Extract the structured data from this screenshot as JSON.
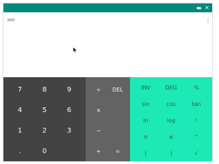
{
  "window": {
    "controls": [
      {
        "name": "minimize-icon",
        "glyph": "▬"
      },
      {
        "name": "close-icon",
        "glyph": "✕"
      }
    ]
  },
  "display": {
    "mode": "RAD",
    "menu_glyph": "⋮"
  },
  "numpad": {
    "rows": [
      [
        "7",
        "8",
        "9"
      ],
      [
        "4",
        "5",
        "6"
      ],
      [
        "1",
        "2",
        "3"
      ],
      [
        ".",
        "0",
        ""
      ]
    ]
  },
  "operators": {
    "divide": "÷",
    "del": "DEL",
    "multiply": "×",
    "minus": "−",
    "plus": "+",
    "equals": "="
  },
  "advanced": {
    "rows": [
      [
        "INV",
        "DEG",
        "%"
      ],
      [
        "sin",
        "cos",
        "tan"
      ],
      [
        "ln",
        "log",
        "!"
      ],
      [
        "π",
        "e",
        "^"
      ],
      [
        "(",
        ")",
        "√"
      ]
    ]
  },
  "colors": {
    "titlebar": "#00897b",
    "numpad_bg": "#434343",
    "operator_bg": "#636363",
    "advanced_bg": "#1de9b6"
  }
}
